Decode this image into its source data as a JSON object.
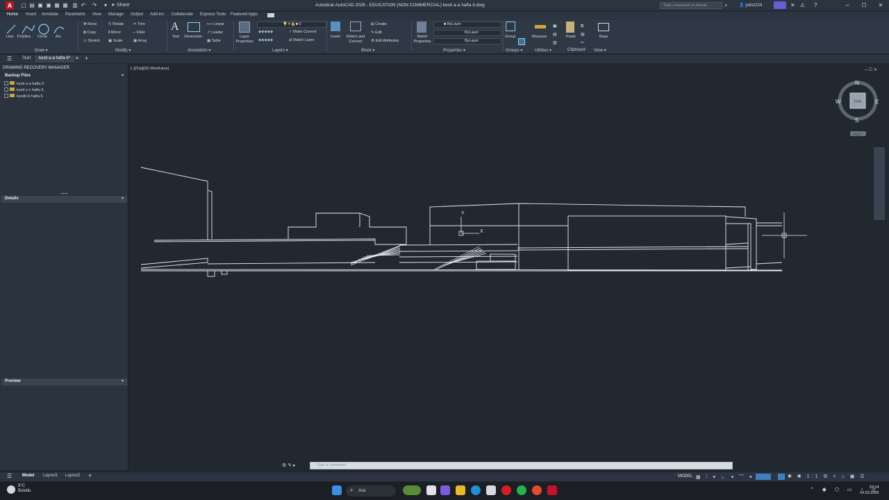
{
  "titlebar": {
    "app_logo": "A",
    "share": "Share",
    "title": "Autodesk AutoCAD 2026 - EDUCATION (NON COMMERCIAL)   kesit a-a hafta 6.dwg",
    "search_placeholder": "Type a keyword or phrase",
    "user": "yıldız224",
    "minimize": "─",
    "maximize": "☐",
    "close": "✕"
  },
  "ribbon_tabs": [
    "Home",
    "Insert",
    "Annotate",
    "Parametric",
    "View",
    "Manage",
    "Output",
    "Add-ins",
    "Collaborate",
    "Express Tools",
    "Featured Apps"
  ],
  "ribbon": {
    "draw": {
      "line": "Line",
      "polyline": "Polyline",
      "circle": "Circle",
      "arc": "Arc",
      "title": "Draw ▾"
    },
    "modify": {
      "move": "Move",
      "rotate": "Rotate",
      "trim": "Trim",
      "copy": "Copy",
      "mirror": "Mirror",
      "fillet": "Fillet",
      "stretch": "Stretch",
      "scale": "Scale",
      "array": "Array",
      "title": "Modify ▾"
    },
    "annotation": {
      "text": "Text",
      "dimension": "Dimension",
      "linear": "Linear",
      "leader": "Leader",
      "table": "Table",
      "title": "Annotation ▾"
    },
    "layers": {
      "properties": "Layer Properties",
      "current_layer": "0",
      "make_current": "Make Current",
      "match_layer": "Match Layer",
      "title": "Layers ▾"
    },
    "block": {
      "insert": "Insert",
      "detect": "Detect and Convert",
      "create": "Create",
      "edit": "Edit",
      "edit_attributes": "Edit Attributes",
      "title": "Block ▾"
    },
    "properties": {
      "match": "Match Properties",
      "color": "ByLayer",
      "linetype": "ByLayer",
      "lineweight": "ByLayer",
      "title": "Properties ▾"
    },
    "groups": {
      "group": "Group",
      "title": "Groups ▾"
    },
    "utilities": {
      "measure": "Measure",
      "title": "Utilities ▾"
    },
    "clipboard": {
      "paste": "Paste",
      "title": "Clipboard"
    },
    "view": {
      "base": "Base",
      "title": "View ▾"
    }
  },
  "filetabs": {
    "start": "Start",
    "active": "kesit a-a hafta 6*"
  },
  "recovery": {
    "title": "DRAWING RECOVERY MANAGER",
    "backup_files": "Backup Files",
    "files": [
      "kesit a-a  hafta 6",
      "kesit c-c hafta 6",
      "kesitb-b hafta 6"
    ],
    "details": "Details",
    "preview": "Preview"
  },
  "viewport_label": "[−][Top][2D Wireframe]",
  "viewcube": {
    "n": "N",
    "s": "S",
    "e": "E",
    "w": "W",
    "top": "TOP",
    "wcs": "WCS"
  },
  "ucs": {
    "x": "X",
    "y": "Y"
  },
  "cmdline": {
    "placeholder": "Type a command"
  },
  "layout_tabs": [
    "Model",
    "Layout1",
    "Layout2"
  ],
  "status": {
    "model": "MODEL"
  },
  "taskbar": {
    "weather_temp": "9°C",
    "weather_desc": "Bulutlu",
    "search": "Ara",
    "time": "23:14",
    "date": "24.03.2026"
  }
}
